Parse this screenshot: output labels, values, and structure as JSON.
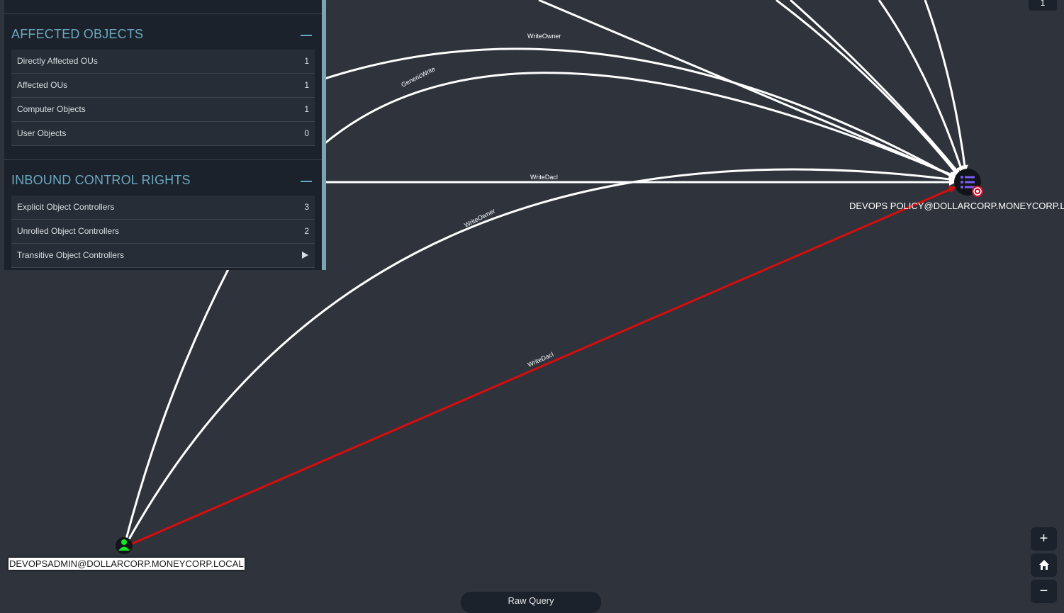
{
  "panel": {
    "affected_objects": {
      "title": "AFFECTED OBJECTS",
      "rows": [
        {
          "label": "Directly Affected OUs",
          "count": "1"
        },
        {
          "label": "Affected OUs",
          "count": "1"
        },
        {
          "label": "Computer Objects",
          "count": "1"
        },
        {
          "label": "User Objects",
          "count": "0"
        }
      ]
    },
    "inbound_control_rights": {
      "title": "INBOUND CONTROL RIGHTS",
      "rows": [
        {
          "label": "Explicit Object Controllers",
          "count": "3"
        },
        {
          "label": "Unrolled Object Controllers",
          "count": "2"
        },
        {
          "label": "Transitive Object Controllers",
          "count": ""
        }
      ]
    }
  },
  "graph": {
    "source_node": {
      "label": "DEVOPSADMIN@DOLLARCORP.MONEYCORP.LOCAL",
      "color": "#17e625"
    },
    "target_node": {
      "label": "DEVOPS POLICY@DOLLARCORP.MONEYCORP.LOCAL",
      "color": "#7b5cf5"
    },
    "edges": {
      "write_owner_top": "WriteOwner",
      "generic_write": "GenericWrite",
      "write_dacl_mid": "WriteDacl",
      "write_owner_mid": "WriteOwner",
      "write_dacl_path": "WriteDacl"
    },
    "path_color": "#d80d0d"
  },
  "controls": {
    "zoom_in": "+",
    "home": "home-icon",
    "zoom_out": "−",
    "raw_query": "Raw Query",
    "top_right": "1"
  }
}
